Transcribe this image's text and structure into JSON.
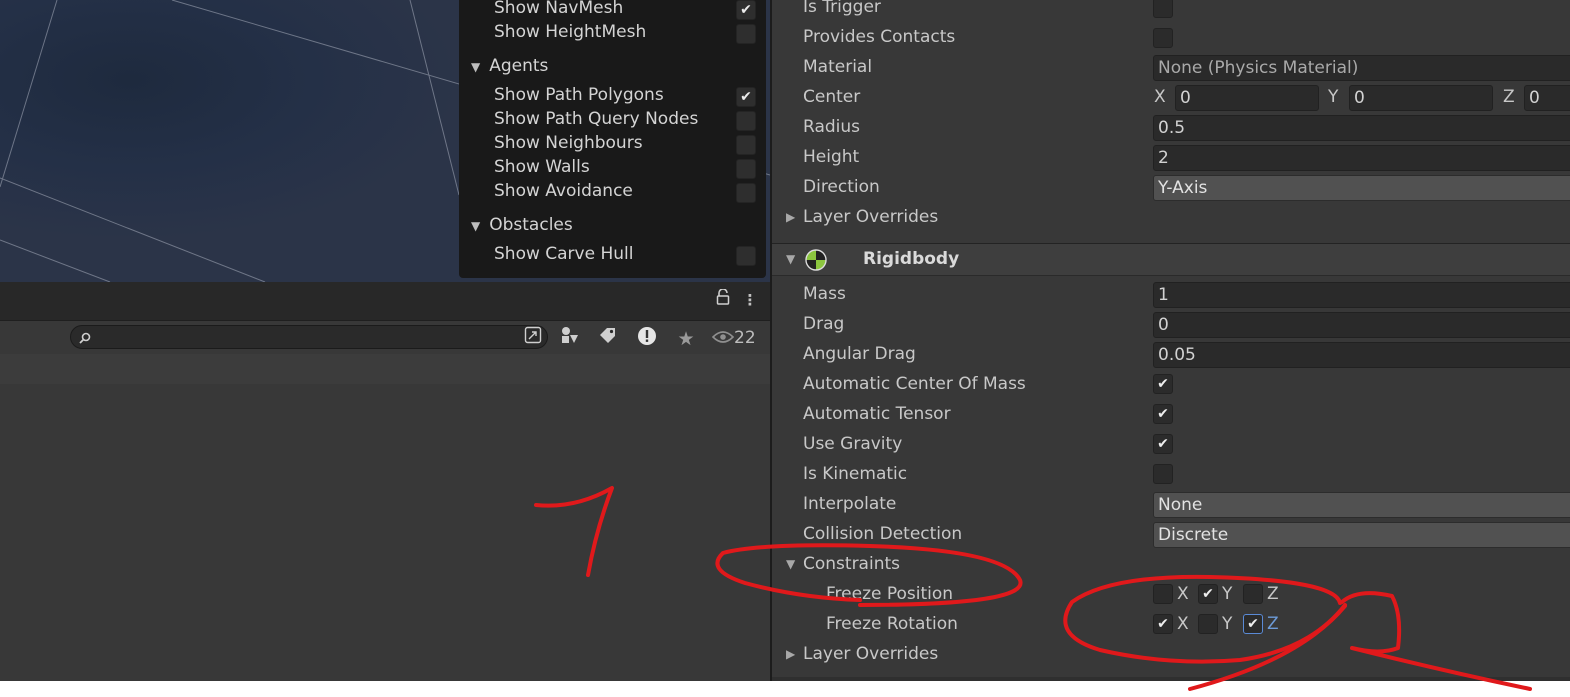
{
  "overlay": {
    "navmesh_rows": [
      {
        "label": "Show NavMesh",
        "checked": true
      },
      {
        "label": "Show HeightMesh",
        "checked": false
      }
    ],
    "agents_header": "Agents",
    "agents_rows": [
      {
        "label": "Show Path Polygons",
        "checked": true
      },
      {
        "label": "Show Path Query Nodes",
        "checked": false
      },
      {
        "label": "Show Neighbours",
        "checked": false
      },
      {
        "label": "Show Walls",
        "checked": false
      },
      {
        "label": "Show Avoidance",
        "checked": false
      }
    ],
    "obstacles_header": "Obstacles",
    "obstacles_rows": [
      {
        "label": "Show Carve Hull",
        "checked": false
      }
    ]
  },
  "search": {
    "placeholder": "",
    "hidden_count": "22",
    "icons": [
      "search-icon",
      "scene-search-icon",
      "type-filter-icon",
      "label-filter-icon",
      "log-filter-icon",
      "favorites-icon",
      "visibility-icon"
    ]
  },
  "toolbar": {
    "icons": [
      "lock-icon",
      "more-menu-icon"
    ]
  },
  "collider": {
    "is_trigger": "Is Trigger",
    "provides_contacts": "Provides Contacts",
    "material_label": "Material",
    "material_value": "None (Physics Material)",
    "center_label": "Center",
    "center": {
      "x_label": "X",
      "x": "0",
      "y_label": "Y",
      "y": "0",
      "z_label": "Z",
      "z": "0"
    },
    "radius_label": "Radius",
    "radius": "0.5",
    "height_label": "Height",
    "height": "2",
    "direction_label": "Direction",
    "direction": "Y-Axis",
    "layer_overrides": "Layer Overrides"
  },
  "rigidbody": {
    "title": "Rigidbody",
    "mass_label": "Mass",
    "mass": "1",
    "drag_label": "Drag",
    "drag": "0",
    "angular_drag_label": "Angular Drag",
    "angular_drag": "0.05",
    "auto_com_label": "Automatic Center Of Mass",
    "auto_com": true,
    "auto_tensor_label": "Automatic Tensor",
    "auto_tensor": true,
    "use_gravity_label": "Use Gravity",
    "use_gravity": true,
    "is_kinematic_label": "Is Kinematic",
    "is_kinematic": false,
    "interpolate_label": "Interpolate",
    "interpolate": "None",
    "collision_label": "Collision Detection",
    "collision": "Discrete",
    "constraints_label": "Constraints",
    "freeze_position_label": "Freeze Position",
    "freeze_position": {
      "x": false,
      "y": true,
      "z": false
    },
    "freeze_rotation_label": "Freeze Rotation",
    "freeze_rotation": {
      "x": true,
      "y": false,
      "z": true
    },
    "axis_labels": {
      "x": "X",
      "y": "Y",
      "z": "Z"
    },
    "layer_overrides": "Layer Overrides"
  },
  "annotations": {
    "color": "#e0191b",
    "shapes": [
      "digit-one-scribble",
      "ellipse-around-constraints",
      "ellipse-around-freeze-checkboxes",
      "arrow-scribble"
    ]
  },
  "colors": {
    "panel": "#383838",
    "field": "#2a2a2a",
    "dropdown": "#515151",
    "overlay": "#191919",
    "accent_blue": "#6d9bd8"
  }
}
